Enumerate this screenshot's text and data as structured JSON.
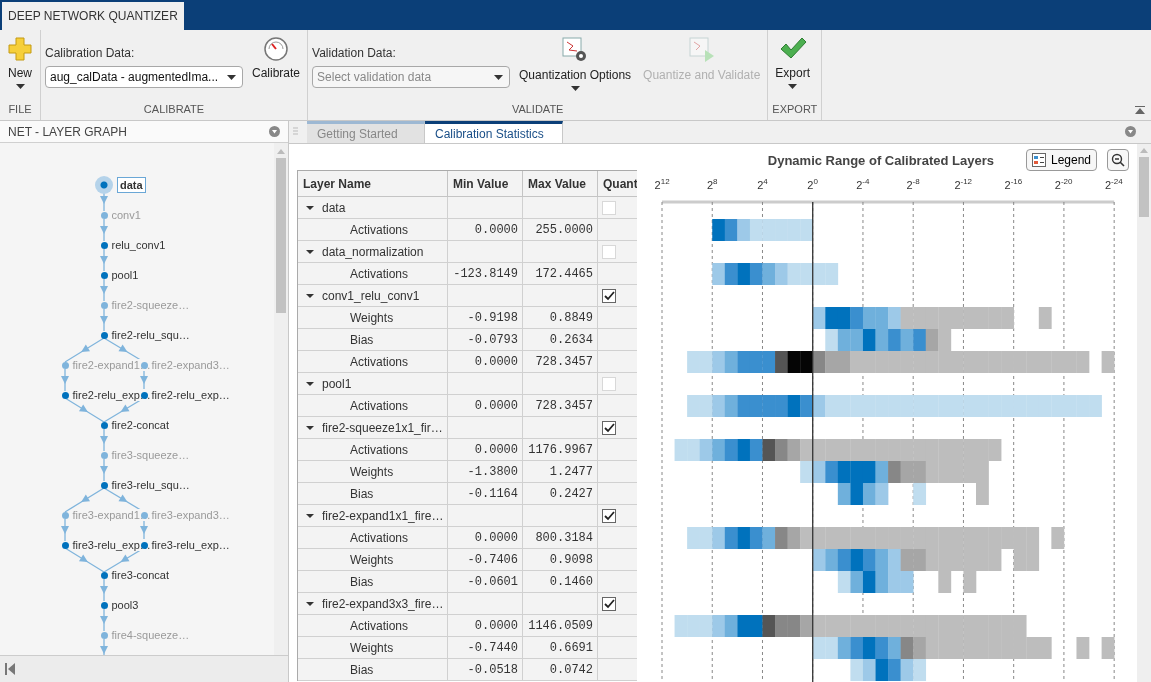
{
  "app_tab": {
    "label": "DEEP NETWORK QUANTIZER",
    "selected": true
  },
  "toolstrip": {
    "sections": [
      {
        "title": "FILE",
        "items": [
          {
            "kind": "big_button",
            "label": "New",
            "dropdown": true,
            "disabled": false
          }
        ]
      },
      {
        "title": "CALIBRATE",
        "items": [
          {
            "kind": "select",
            "label": "Calibration Data:",
            "value": "aug_calData - augmentedIma..."
          },
          {
            "kind": "big_button",
            "label": "Calibrate",
            "dropdown": false,
            "disabled": false
          }
        ]
      },
      {
        "title": "VALIDATE",
        "items": [
          {
            "kind": "select",
            "label": "Validation Data:",
            "placeholder": "Select validation data"
          },
          {
            "kind": "big_button",
            "label": "Quantization Options",
            "dropdown": true,
            "disabled": false
          },
          {
            "kind": "big_button",
            "label": "Quantize and Validate",
            "dropdown": false,
            "disabled": true
          }
        ]
      },
      {
        "title": "EXPORT",
        "items": [
          {
            "kind": "big_button",
            "label": "Export",
            "dropdown": true,
            "disabled": false
          }
        ]
      }
    ]
  },
  "layer_graph": {
    "title": "NET - LAYER GRAPH",
    "rows": [
      [
        {
          "label": "data",
          "faded": false,
          "selected": true
        }
      ],
      [
        {
          "label": "conv1",
          "faded": true,
          "selected": false
        }
      ],
      [
        {
          "label": "relu_conv1",
          "faded": false,
          "selected": false
        }
      ],
      [
        {
          "label": "pool1",
          "faded": false,
          "selected": false
        }
      ],
      [
        {
          "label": "fire2-squeeze…",
          "faded": true,
          "selected": false
        }
      ],
      [
        {
          "label": "fire2-relu_squ…",
          "faded": false,
          "selected": false
        }
      ],
      [
        {
          "label": "fire2-expand1…",
          "faded": true,
          "selected": false
        },
        {
          "label": "fire2-expand3…",
          "faded": true,
          "selected": false
        }
      ],
      [
        {
          "label": "fire2-relu_exp…",
          "faded": false,
          "selected": false
        },
        {
          "label": "fire2-relu_exp…",
          "faded": false,
          "selected": false
        }
      ],
      [
        {
          "label": "fire2-concat",
          "faded": false,
          "selected": false
        }
      ],
      [
        {
          "label": "fire3-squeeze…",
          "faded": true,
          "selected": false
        }
      ],
      [
        {
          "label": "fire3-relu_squ…",
          "faded": false,
          "selected": false
        }
      ],
      [
        {
          "label": "fire3-expand1…",
          "faded": true,
          "selected": false
        },
        {
          "label": "fire3-expand3…",
          "faded": true,
          "selected": false
        }
      ],
      [
        {
          "label": "fire3-relu_exp…",
          "faded": false,
          "selected": false
        },
        {
          "label": "fire3-relu_exp…",
          "faded": false,
          "selected": false
        }
      ],
      [
        {
          "label": "fire3-concat",
          "faded": false,
          "selected": false
        }
      ],
      [
        {
          "label": "pool3",
          "faded": false,
          "selected": false
        }
      ],
      [
        {
          "label": "fire4-squeeze…",
          "faded": true,
          "selected": false
        }
      ]
    ]
  },
  "doc_tabs": [
    {
      "label": "Getting Started",
      "selected": false
    },
    {
      "label": "Calibration Statistics",
      "selected": true
    }
  ],
  "table": {
    "columns": [
      "Layer Name",
      "Min Value",
      "Max Value",
      "Quant"
    ],
    "layers": [
      {
        "name": "data",
        "expanded": true,
        "checked": false,
        "disabled": true,
        "stats": [
          {
            "name": "Activations",
            "min": "0.0000",
            "max": "255.0000"
          }
        ]
      },
      {
        "name": "data_normalization",
        "expanded": true,
        "checked": false,
        "disabled": true,
        "stats": [
          {
            "name": "Activations",
            "min": "-123.8149",
            "max": "172.4465"
          }
        ]
      },
      {
        "name": "conv1_relu_conv1",
        "expanded": true,
        "checked": true,
        "disabled": false,
        "stats": [
          {
            "name": "Weights",
            "min": "-0.9198",
            "max": "0.8849"
          },
          {
            "name": "Bias",
            "min": "-0.0793",
            "max": "0.2634"
          },
          {
            "name": "Activations",
            "min": "0.0000",
            "max": "728.3457"
          }
        ]
      },
      {
        "name": "pool1",
        "expanded": true,
        "checked": false,
        "disabled": true,
        "stats": [
          {
            "name": "Activations",
            "min": "0.0000",
            "max": "728.3457"
          }
        ]
      },
      {
        "name": "fire2-squeeze1x1_fir…",
        "expanded": true,
        "checked": true,
        "disabled": false,
        "stats": [
          {
            "name": "Activations",
            "min": "0.0000",
            "max": "1176.9967"
          },
          {
            "name": "Weights",
            "min": "-1.3800",
            "max": "1.2477"
          },
          {
            "name": "Bias",
            "min": "-0.1164",
            "max": "0.2427"
          }
        ]
      },
      {
        "name": "fire2-expand1x1_fire…",
        "expanded": true,
        "checked": true,
        "disabled": false,
        "stats": [
          {
            "name": "Activations",
            "min": "0.0000",
            "max": "800.3184"
          },
          {
            "name": "Weights",
            "min": "-0.7406",
            "max": "0.9098"
          },
          {
            "name": "Bias",
            "min": "-0.0601",
            "max": "0.1460"
          }
        ]
      },
      {
        "name": "fire2-expand3x3_fire…",
        "expanded": true,
        "checked": true,
        "disabled": false,
        "stats": [
          {
            "name": "Activations",
            "min": "0.0000",
            "max": "1146.0509"
          },
          {
            "name": "Weights",
            "min": "-0.7440",
            "max": "0.6691"
          },
          {
            "name": "Bias",
            "min": "-0.0518",
            "max": "0.0742"
          }
        ]
      }
    ]
  },
  "chart": {
    "title": "Dynamic Range of Calibrated Layers",
    "legend_button": "Legend",
    "ticks": [
      "2$^{12}$",
      "2$^{8}$",
      "2$^{4}$",
      "2$^{0}$",
      "2$^{-4}$",
      "2$^{-8}$",
      "2$^{-12}$",
      "2$^{-16}$",
      "2$^{-20}$",
      "2$^{-24}$"
    ]
  }
}
